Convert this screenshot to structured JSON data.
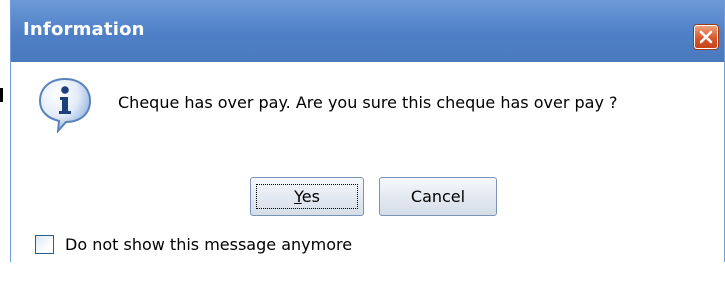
{
  "dialog": {
    "title": "Information",
    "message": "Cheque has over pay. Are you sure this cheque has over pay ?",
    "icon": "information-icon",
    "close_icon": "close-icon",
    "buttons": {
      "yes_mnemonic": "Y",
      "yes_rest": "es",
      "cancel": "Cancel"
    },
    "checkbox": {
      "label": "Do not show this message anymore",
      "checked": false
    }
  },
  "colors": {
    "titlebar": "#4f7fc6",
    "title_text": "#ffffff",
    "close_button": "#d9572a"
  }
}
